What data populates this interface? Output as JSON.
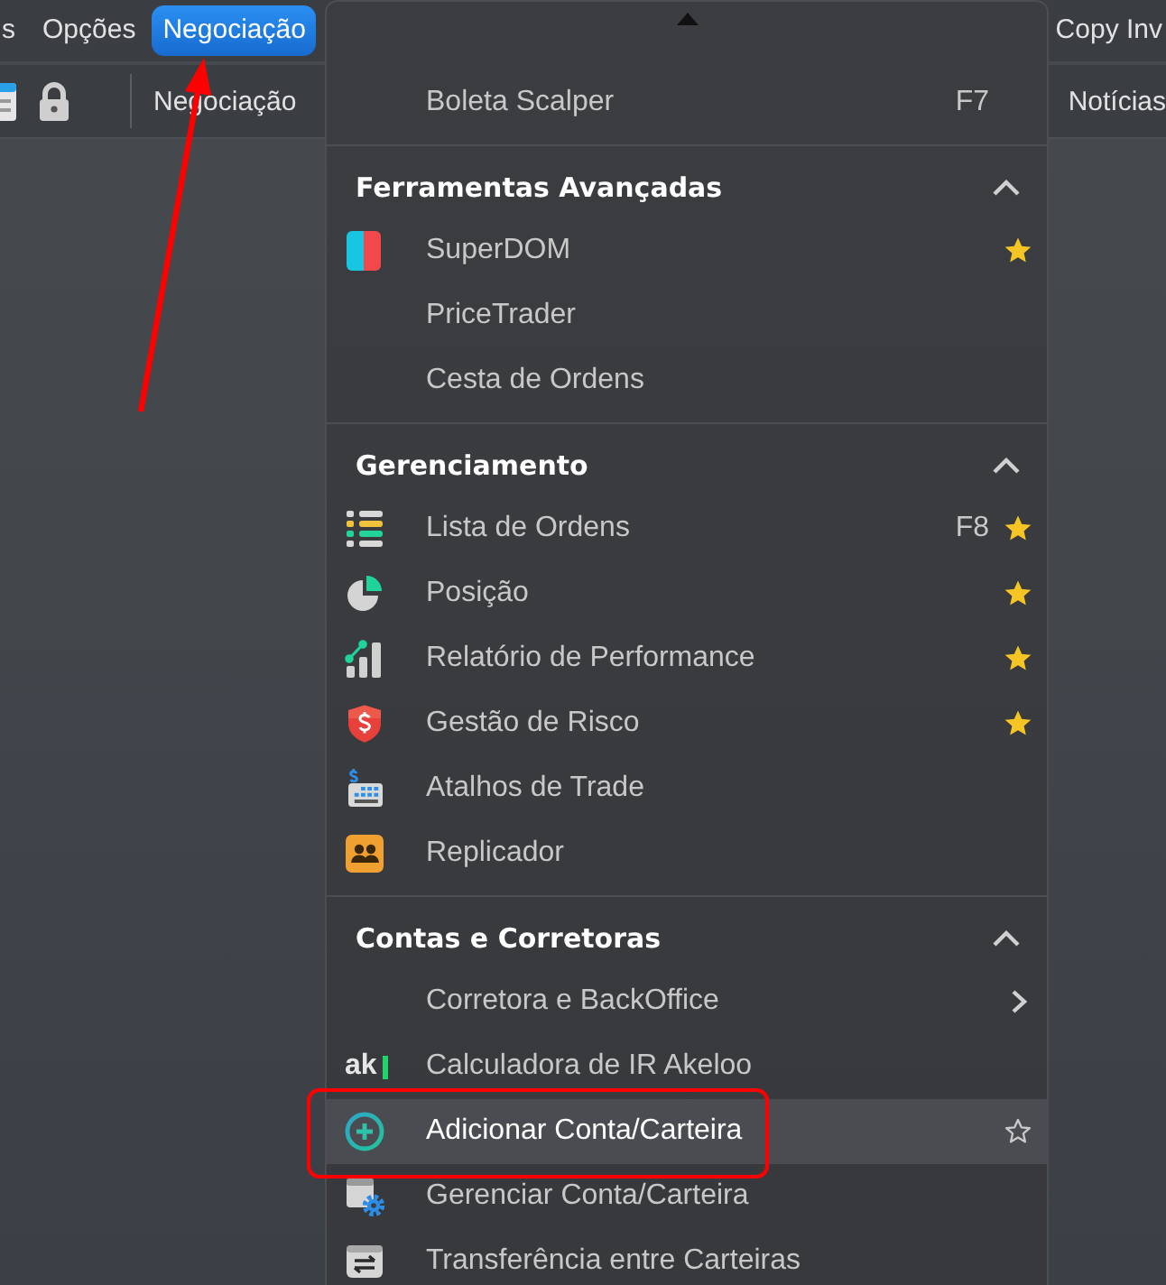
{
  "menu_bar": {
    "left_items": [
      {
        "label": "s",
        "selected": false
      },
      {
        "label": "Opções",
        "selected": false
      },
      {
        "label": "Negociação",
        "selected": true
      }
    ],
    "right_items": [
      {
        "label": "Copy Inv",
        "selected": false
      }
    ]
  },
  "toolbar": {
    "left_label": "Negociação",
    "right_label": "Notícias"
  },
  "dropdown": {
    "items": [
      {
        "label": "Boleta Scalper",
        "shortcut": "F7",
        "favorite": false,
        "highlighted": false,
        "submenu": false
      }
    ],
    "sections": [
      {
        "title": "Ferramentas Avançadas",
        "expanded": true,
        "items": [
          {
            "label": "SuperDOM",
            "favorite": true,
            "highlighted": false,
            "submenu": false
          },
          {
            "label": "PriceTrader",
            "favorite": false,
            "highlighted": false,
            "submenu": false
          },
          {
            "label": "Cesta de Ordens",
            "favorite": false,
            "highlighted": false,
            "submenu": false
          }
        ]
      },
      {
        "title": "Gerenciamento",
        "expanded": true,
        "items": [
          {
            "label": "Lista de Ordens",
            "shortcut": "F8",
            "favorite": true,
            "highlighted": false,
            "submenu": false
          },
          {
            "label": "Posição",
            "favorite": true,
            "highlighted": false,
            "submenu": false
          },
          {
            "label": "Relatório de Performance",
            "favorite": true,
            "highlighted": false,
            "submenu": false
          },
          {
            "label": "Gestão de Risco",
            "favorite": true,
            "highlighted": false,
            "submenu": false
          },
          {
            "label": "Atalhos de Trade",
            "favorite": false,
            "highlighted": false,
            "submenu": false
          },
          {
            "label": "Replicador",
            "favorite": false,
            "highlighted": false,
            "submenu": false
          }
        ]
      },
      {
        "title": "Contas e Corretoras",
        "expanded": true,
        "items": [
          {
            "label": "Corretora e BackOffice",
            "favorite": false,
            "highlighted": false,
            "submenu": true
          },
          {
            "label": "Calculadora de IR Akeloo",
            "logo_text": "ak",
            "favorite": false,
            "highlighted": false,
            "submenu": false
          },
          {
            "label": "Adicionar Conta/Carteira",
            "favorite": false,
            "highlighted": true,
            "submenu": false
          },
          {
            "label": "Gerenciar Conta/Carteira",
            "favorite": false,
            "highlighted": false,
            "submenu": false
          },
          {
            "label": "Transferência entre Carteiras",
            "favorite": false,
            "highlighted": false,
            "submenu": false
          }
        ]
      }
    ]
  }
}
